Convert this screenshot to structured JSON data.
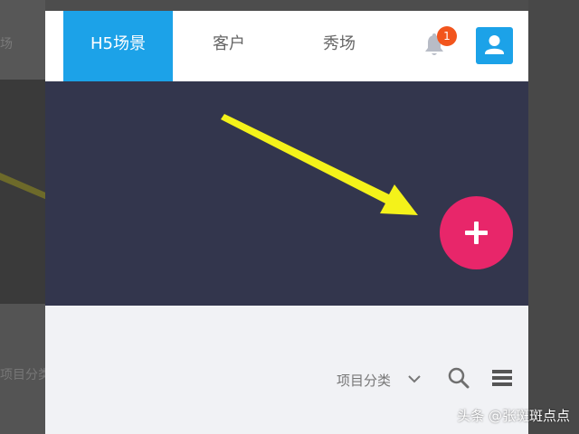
{
  "background": {
    "left_text_top": "场",
    "left_text_bottom": "项目分类"
  },
  "topbar": {
    "tabs": [
      {
        "label": "H5场景",
        "active": true
      },
      {
        "label": "客户",
        "active": false
      },
      {
        "label": "秀场",
        "active": false
      }
    ],
    "notification_count": "1",
    "icons": {
      "bell": "bell-icon",
      "avatar": "user-avatar-icon"
    }
  },
  "hero": {
    "fab_icon": "plus-icon",
    "annotation": "arrow-icon"
  },
  "toolbar": {
    "filter_label": "项目分类",
    "icons": {
      "chevron": "chevron-down-icon",
      "search": "search-icon",
      "menu": "menu-icon"
    }
  },
  "watermark": "头条 @张斑斑点点",
  "colors": {
    "accent": "#1ca2e8",
    "hero_bg": "#33364d",
    "fab": "#e8266a",
    "badge": "#f2551d",
    "arrow": "#f4f21a"
  }
}
